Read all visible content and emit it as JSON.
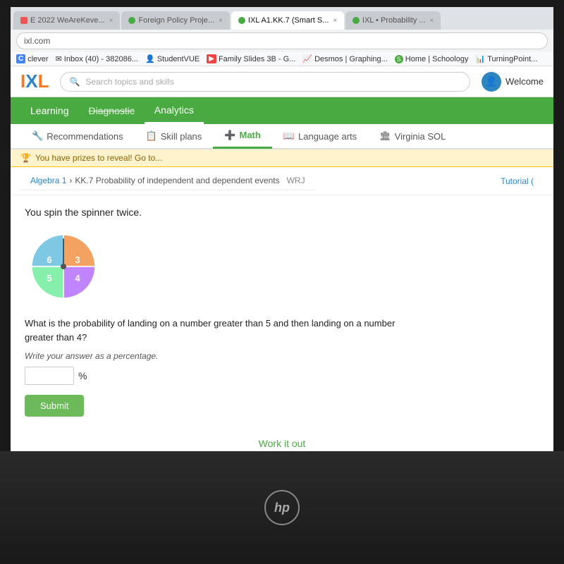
{
  "browser": {
    "address": "ixl.com",
    "tabs": [
      {
        "label": "E 2022 WeAreKeve...",
        "active": false
      },
      {
        "label": "Foreign Policy Proje...",
        "active": false
      },
      {
        "label": "IXL A1.KK.7 (Smart S...",
        "active": true
      },
      {
        "label": "IXL • Probability ...",
        "active": false
      }
    ],
    "bookmarks": [
      {
        "label": "clever"
      },
      {
        "label": "Inbox (40) - 382086..."
      },
      {
        "label": "StudentVUE"
      },
      {
        "label": "Family Slides 3B - G..."
      },
      {
        "label": "Desmos | Graphing..."
      },
      {
        "label": "Home | Schoology"
      },
      {
        "label": "TurningPoint..."
      }
    ]
  },
  "ixl": {
    "logo": "IXL",
    "search_placeholder": "Search topics and skills",
    "welcome": "Welcome",
    "nav": {
      "items": [
        "Learning",
        "Diagnostic",
        "Analytics"
      ],
      "active": "Learning"
    },
    "subnav": {
      "items": [
        "Recommendations",
        "Skill plans",
        "Math",
        "Language arts",
        "Virginia SOL"
      ],
      "active": "Math"
    },
    "prizes_bar": "You have prizes to reveal! Go to...",
    "breadcrumb": {
      "root": "Algebra 1",
      "section": "KK.7 Probability of independent and dependent events",
      "code": "WRJ"
    },
    "tutorial": "Tutorial (",
    "content": {
      "question": "You spin the spinner twice.",
      "spinner": {
        "sections": [
          {
            "label": "6",
            "color": "#7ec8e3",
            "startAngle": 180,
            "endAngle": 270
          },
          {
            "label": "3",
            "color": "#f4a261",
            "startAngle": 270,
            "endAngle": 0
          },
          {
            "label": "4",
            "color": "#c084fc",
            "startAngle": 0,
            "endAngle": 90
          },
          {
            "label": "5",
            "color": "#86efac",
            "startAngle": 90,
            "endAngle": 180
          }
        ]
      },
      "problem": "What is the probability of landing on a number greater than 5 and then landing on a number greater than 4?",
      "write_answer": "Write your answer as a percentage.",
      "answer_input_value": "",
      "percent": "%",
      "submit_label": "Submit",
      "work_it_out": "Work it out"
    }
  },
  "hp_logo": "hp"
}
